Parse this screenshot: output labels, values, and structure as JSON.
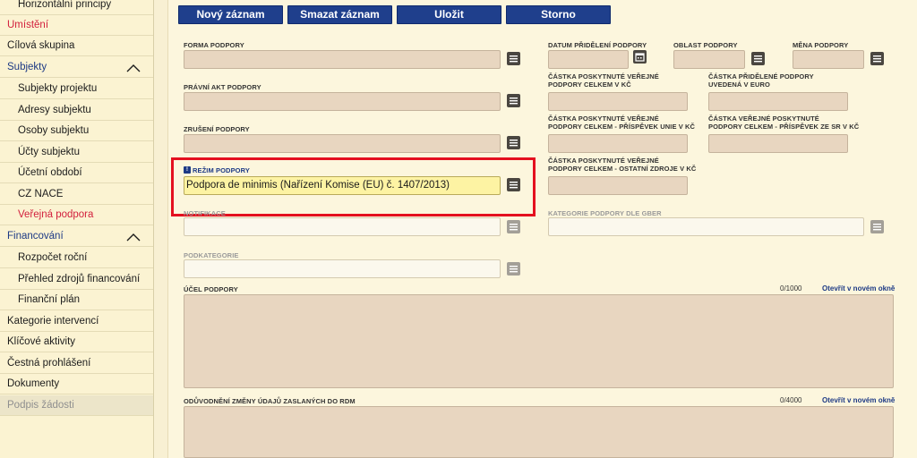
{
  "sidebar": {
    "items": [
      {
        "label": "Horizontální principy"
      },
      {
        "label": "Umístění"
      },
      {
        "label": "Cílová skupina"
      },
      {
        "label": "Subjekty"
      },
      {
        "label": "Subjekty projektu"
      },
      {
        "label": "Adresy subjektu"
      },
      {
        "label": "Osoby subjektu"
      },
      {
        "label": "Účty subjektu"
      },
      {
        "label": "Účetní období"
      },
      {
        "label": "CZ NACE"
      },
      {
        "label": "Veřejná podpora"
      },
      {
        "label": "Financování"
      },
      {
        "label": "Rozpočet roční"
      },
      {
        "label": "Přehled zdrojů financování"
      },
      {
        "label": "Finanční plán"
      },
      {
        "label": "Kategorie intervencí"
      },
      {
        "label": "Klíčové aktivity"
      },
      {
        "label": "Čestná prohlášení"
      },
      {
        "label": "Dokumenty"
      },
      {
        "label": "Podpis žádosti"
      }
    ]
  },
  "toolbar": {
    "new_label": "Nový záznam",
    "delete_label": "Smazat záznam",
    "save_label": "Uložit",
    "cancel_label": "Storno"
  },
  "form": {
    "forma_podpory": {
      "label": "FORMA PODPORY",
      "value": ""
    },
    "pravni_akt": {
      "label": "PRÁVNÍ AKT PODPORY",
      "value": ""
    },
    "zruseni": {
      "label": "ZRUŠENÍ PODPORY",
      "value": ""
    },
    "rezim": {
      "label": "REŽIM PODPORY",
      "badge": "!",
      "value": "Podpora de minimis (Nařízení Komise (EU) č. 1407/2013)"
    },
    "notifikace": {
      "label": "NOTIFIKACE",
      "value": ""
    },
    "podkategorie": {
      "label": "PODKATEGORIE",
      "value": ""
    },
    "datum": {
      "label": "DATUM PŘIDĚLENÍ PODPORY",
      "value": ""
    },
    "oblast": {
      "label": "OBLAST PODPORY",
      "value": ""
    },
    "mena": {
      "label": "MĚNA PODPORY",
      "value": ""
    },
    "castka_kc": {
      "label1": "ČÁSTKA POSKYTNUTÉ VEŘEJNÉ",
      "label2": "PODPORY CELKEM V KČ",
      "value": ""
    },
    "castka_euro": {
      "label1": "ČÁSTKA PŘIDĚLENÉ PODPORY",
      "label2": "UVEDENÁ V EURO",
      "value": ""
    },
    "castka_unie": {
      "label1": "ČÁSTKA POSKYTNUTÉ VEŘEJNÉ",
      "label2": "PODPORY CELKEM - PŘÍSPĚVEK UNIE V KČ",
      "value": ""
    },
    "castka_sr": {
      "label1": "ČÁSTKA VEŘEJNÉ POSKYTNUTÉ",
      "label2": "PODPORY CELKEM - PŘÍSPĚVEK ZE SR V KČ",
      "value": ""
    },
    "castka_ostatni": {
      "label1": "ČÁSTKA POSKYTNUTÉ VEŘEJNÉ",
      "label2": "PODPORY CELKEM - OSTATNÍ ZDROJE V KČ",
      "value": ""
    },
    "kategorie_gber": {
      "label": "KATEGORIE PODPORY DLE GBER",
      "value": ""
    },
    "ucel": {
      "label": "ÚČEL PODPORY",
      "counter": "0/1000",
      "link": "Otevřít v novém okně"
    },
    "oduvodneni": {
      "label": "ODŮVODNĚNÍ ZMĚNY ÚDAJŮ ZASLANÝCH DO RDM",
      "counter": "0/4000",
      "link": "Otevřít v novém okně"
    }
  },
  "colors": {
    "accent": "#1f3f8c",
    "highlight": "#e4101f",
    "field": "#e8d6c0"
  }
}
